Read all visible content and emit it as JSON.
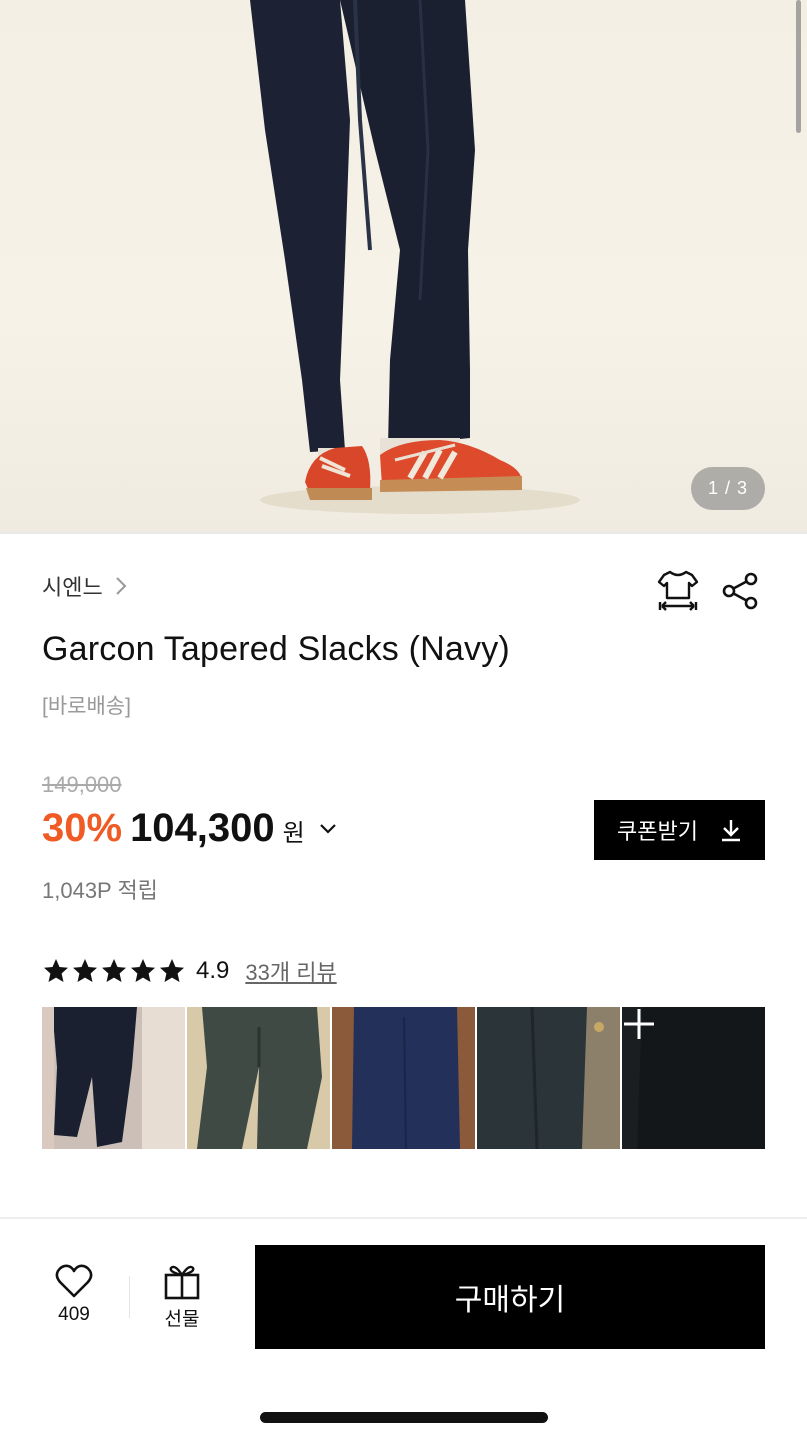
{
  "gallery": {
    "counter": "1 / 3"
  },
  "product": {
    "brand": "시엔느",
    "title": "Garcon Tapered Slacks (Navy)",
    "shipping": "[바로배송]"
  },
  "pricing": {
    "original": "149,000",
    "discount": "30%",
    "price": "104,300",
    "currency": "원",
    "coupon_label": "쿠폰받기",
    "points": "1,043P 적립"
  },
  "reviews": {
    "rating": "4.9",
    "stars": 5,
    "link_label": "33개 리뷰",
    "thumbnails": [
      {
        "name": "review-photo-1"
      },
      {
        "name": "review-photo-2"
      },
      {
        "name": "review-photo-3"
      },
      {
        "name": "review-photo-4"
      },
      {
        "name": "review-photo-more",
        "more": true
      }
    ]
  },
  "bottom_bar": {
    "like_count": "409",
    "gift_label": "선물",
    "buy_label": "구매하기"
  },
  "colors": {
    "discount": "#f05a24",
    "button_bg": "#000000",
    "muted": "#999999"
  },
  "icons": [
    "chevron-right-icon",
    "size-guide-icon",
    "share-icon",
    "chevron-down-icon",
    "download-icon",
    "star-icon",
    "plus-icon",
    "heart-icon",
    "gift-icon"
  ]
}
